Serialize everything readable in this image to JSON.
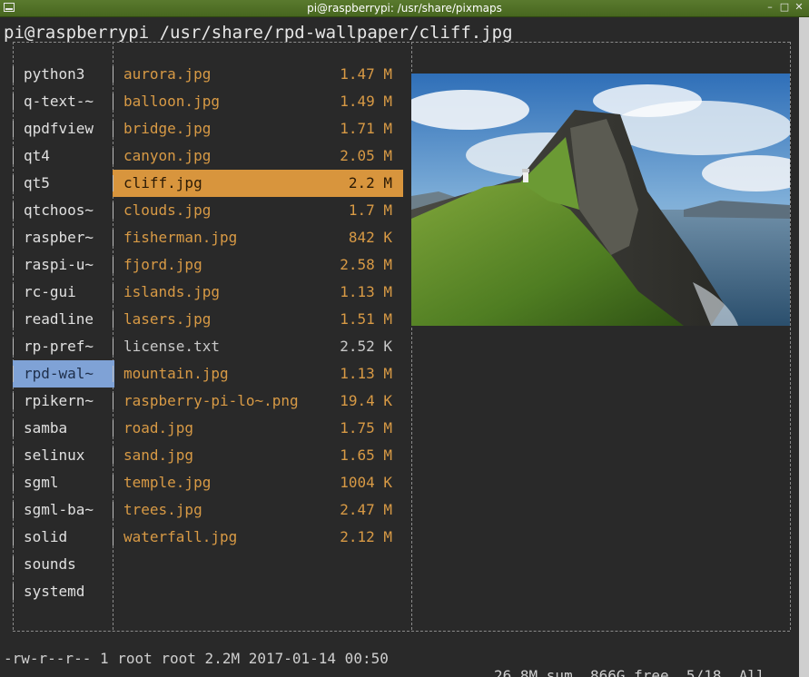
{
  "window": {
    "title": "pi@raspberrypi: /usr/share/pixmaps",
    "titlebar_color": "#4f6f27"
  },
  "prompt": "pi@raspberrypi /usr/share/rpd-wallpaper/cliff.jpg",
  "parent_dirs": [
    {
      "label": "python3"
    },
    {
      "label": "q-text-~"
    },
    {
      "label": "qpdfview"
    },
    {
      "label": "qt4"
    },
    {
      "label": "qt5"
    },
    {
      "label": "qtchoos~"
    },
    {
      "label": "raspber~"
    },
    {
      "label": "raspi-u~"
    },
    {
      "label": "rc-gui"
    },
    {
      "label": "readline"
    },
    {
      "label": "rp-pref~"
    },
    {
      "label": "rpd-wal~",
      "selected": true
    },
    {
      "label": "rpikern~"
    },
    {
      "label": "samba"
    },
    {
      "label": "selinux"
    },
    {
      "label": "sgml"
    },
    {
      "label": "sgml-ba~"
    },
    {
      "label": "solid"
    },
    {
      "label": "sounds"
    },
    {
      "label": "systemd"
    }
  ],
  "files": [
    {
      "name": "aurora.jpg",
      "size": "1.47 M"
    },
    {
      "name": "balloon.jpg",
      "size": "1.49 M"
    },
    {
      "name": "bridge.jpg",
      "size": "1.71 M"
    },
    {
      "name": "canyon.jpg",
      "size": "2.05 M"
    },
    {
      "name": "cliff.jpg",
      "size": "2.2 M",
      "selected": true
    },
    {
      "name": "clouds.jpg",
      "size": "1.7 M"
    },
    {
      "name": "fisherman.jpg",
      "size": "842 K"
    },
    {
      "name": "fjord.jpg",
      "size": "2.58 M"
    },
    {
      "name": "islands.jpg",
      "size": "1.13 M"
    },
    {
      "name": "lasers.jpg",
      "size": "1.51 M"
    },
    {
      "name": "license.txt",
      "size": "2.52 K",
      "plain": true
    },
    {
      "name": "mountain.jpg",
      "size": "1.13 M"
    },
    {
      "name": "raspberry-pi-lo~.png",
      "size": "19.4 K"
    },
    {
      "name": "road.jpg",
      "size": "1.75 M"
    },
    {
      "name": "sand.jpg",
      "size": "1.65 M"
    },
    {
      "name": "temple.jpg",
      "size": "1004 K"
    },
    {
      "name": "trees.jpg",
      "size": "2.47 M"
    },
    {
      "name": "waterfall.jpg",
      "size": "2.12 M"
    }
  ],
  "status": {
    "file_info": "-rw-r--r-- 1 root root 2.2M 2017-01-14 00:50",
    "summary": "26.8M sum, 866G free  5/18  All"
  },
  "colors": {
    "file_text": "#d89a45",
    "file_selected_bg": "#d8953d",
    "dir_selected_bg": "#7fa2d6"
  }
}
